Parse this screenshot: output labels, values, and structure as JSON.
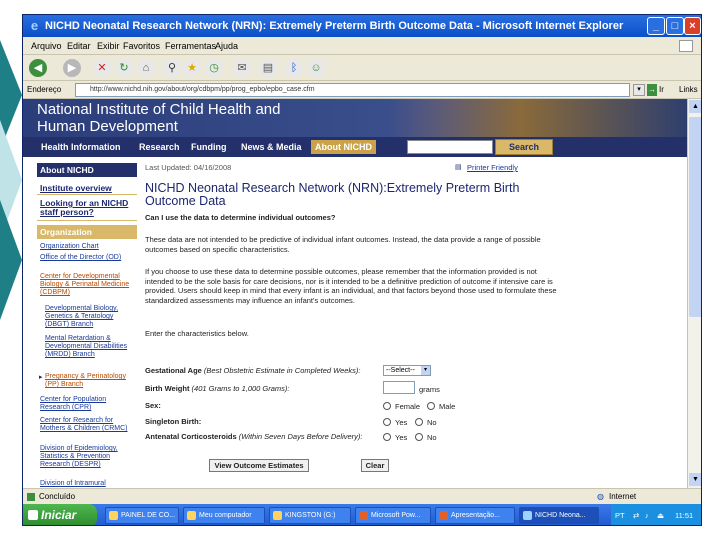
{
  "window": {
    "title": "NICHD Neonatal Research Network (NRN): Extremely Preterm Birth Outcome Data - Microsoft Internet Explorer"
  },
  "menubar": [
    "Arquivo",
    "Editar",
    "Exibir",
    "Favoritos",
    "Ferramentas",
    "Ajuda"
  ],
  "address": {
    "label": "Endereço",
    "url": "http://www.nichd.nih.gov/about/org/cdbpm/pp/prog_epbo/epbo_case.cfm",
    "go_label": "Ir",
    "links_label": "Links"
  },
  "banner": {
    "title": "National Institute of Child Health and Human Development"
  },
  "nav": {
    "items": [
      "Health Information",
      "Research",
      "Funding",
      "News & Media",
      "About NICHD"
    ],
    "search_button": "Search"
  },
  "sidebar": {
    "about": "About NICHD",
    "institute_overview": "Institute overview",
    "looking_for": "Looking for an NICHD staff person?",
    "organization": "Organization",
    "links": [
      "Organization Chart",
      "Office of the Director (OD)",
      "Center for Developmental Biology & Perinatal Medicine (CDBPM)",
      "Developmental Biology, Genetics & Teratology (DBGT) Branch",
      "Mental Retardation & Developmental Disabilities (MRDD) Branch",
      "Pregnancy & Perinatology (PP) Branch",
      "Center for Population Research (CPR)",
      "Center for Research for Mothers & Children (CRMC)",
      "Division of Epidemiology, Statistics & Prevention Research (DESPR)",
      "Division of Intramural"
    ]
  },
  "content": {
    "last_updated": "Last Updated: 04/16/2008",
    "printer_friendly": "Printer Friendly",
    "heading": "NICHD Neonatal Research Network (NRN):Extremely Preterm Birth Outcome Data",
    "question": "Can I use the data to determine individual outcomes?",
    "para1": "These data are not intended to be predictive of individual infant outcomes. Instead, the data provide a range of possible outcomes based on specific characteristics.",
    "para2": "If you choose to use these data to determine possible outcomes, please remember that the information provided is not intended to be the sole basis for care decisions, nor is it intended to be a definitive prediction of outcome if intensive care is provided. Users should keep in mind that every infant is an individual, and that factors beyond those used to formulate these standardized assessments may influence an infant's outcomes.",
    "enter": "Enter the characteristics below."
  },
  "form": {
    "gestational_label": "Gestational Age",
    "gestational_hint": "(Best Obstetric Estimate in Completed Weeks):",
    "gestational_value": "--Select--",
    "weight_label": "Birth Weight",
    "weight_hint": "(401 Grams to 1,000 Grams):",
    "weight_unit": "grams",
    "sex_label": "Sex:",
    "sex_options": [
      "Female",
      "Male"
    ],
    "singleton_label": "Singleton Birth:",
    "antenatal_label": "Antenatal Corticosteroids",
    "antenatal_hint": "(Within Seven Days Before Delivery):",
    "yes_no": [
      "Yes",
      "No"
    ],
    "view_button": "View Outcome Estimates",
    "clear_button": "Clear"
  },
  "status": {
    "left": "Concluído",
    "zone": "Internet"
  },
  "taskbar": {
    "start": "Iniciar",
    "tasks": [
      "PAINEL DE CO...",
      "Meu computador",
      "KINGSTON (G:)",
      "Microsoft Pow...",
      "Apresentação...",
      "NICHD Neona..."
    ],
    "lang": "PT",
    "clock": "11:51"
  },
  "colors": {
    "title_bar": "#0a4fc8",
    "nav_bg": "#23306a",
    "gold_accent": "#d9b969",
    "heading_blue": "#1d2770",
    "slide_teal": "#1f7f86"
  }
}
